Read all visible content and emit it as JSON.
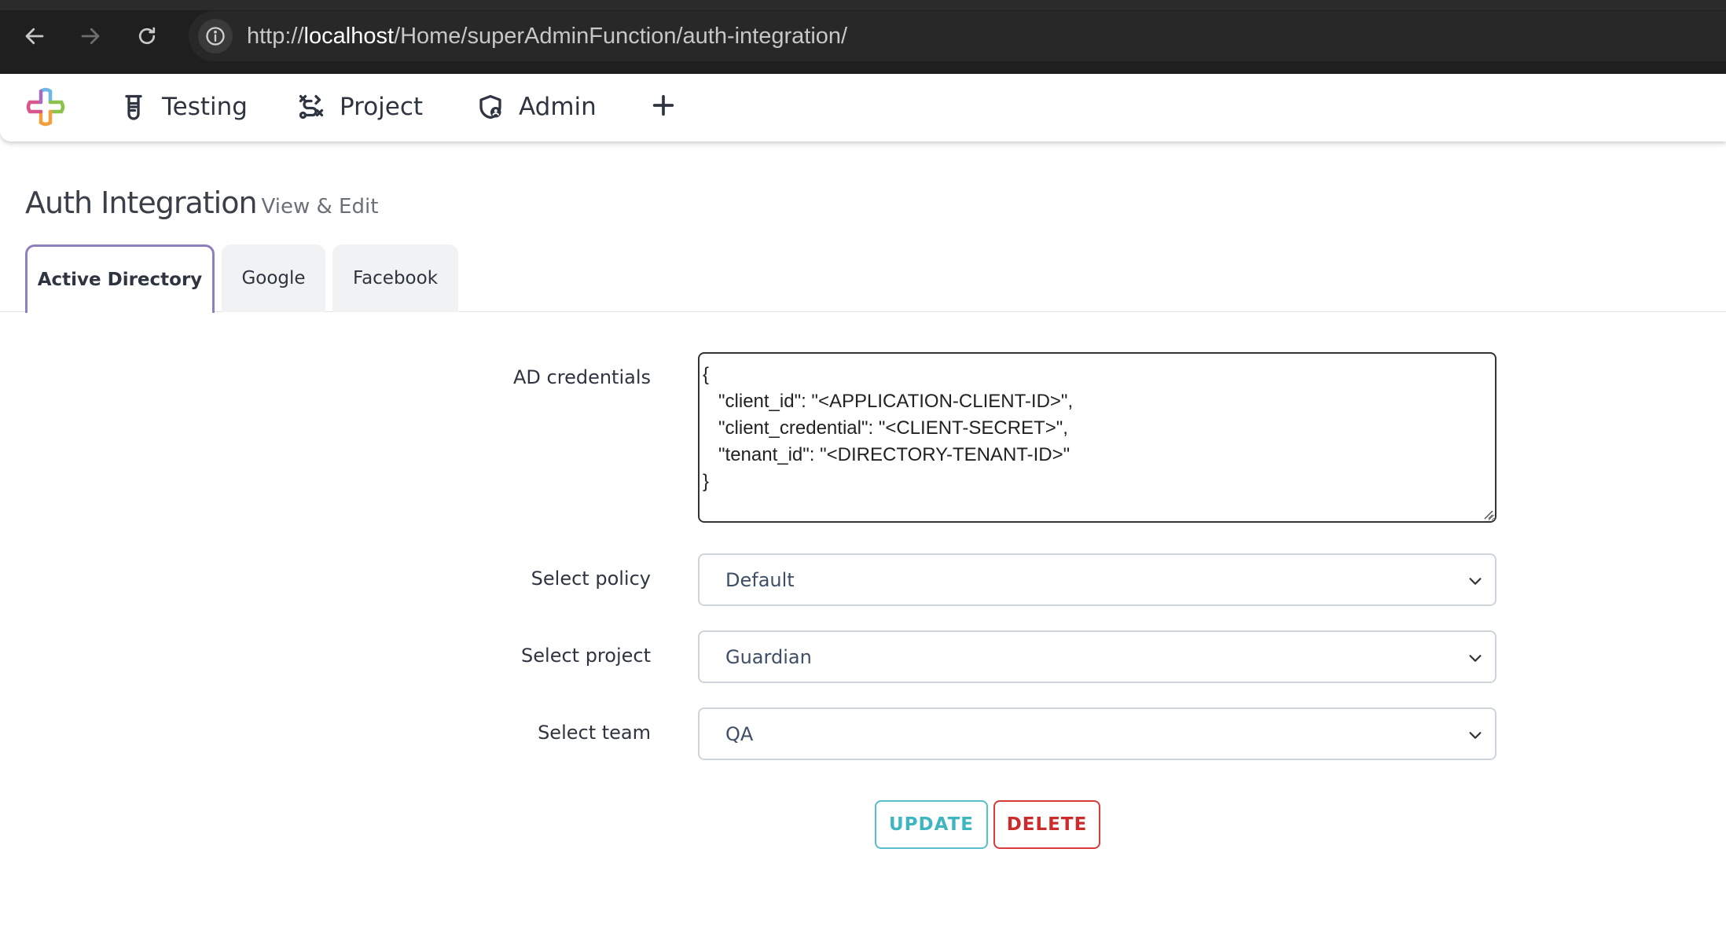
{
  "browser": {
    "url_scheme": "http://",
    "url_host": "localhost",
    "url_path": "/Home/superAdminFunction/auth-integration/"
  },
  "navbar": {
    "items": [
      {
        "label": "Testing",
        "icon": "flask-icon"
      },
      {
        "label": "Project",
        "icon": "route-icon"
      },
      {
        "label": "Admin",
        "icon": "shield-user-icon"
      }
    ],
    "add_icon": "plus-icon"
  },
  "page": {
    "title": "Auth Integration",
    "subtitle": "View & Edit"
  },
  "tabs": [
    {
      "label": "Active Directory",
      "active": true
    },
    {
      "label": "Google",
      "active": false
    },
    {
      "label": "Facebook",
      "active": false
    }
  ],
  "form": {
    "ad_credentials_label": "AD credentials",
    "ad_credentials_value": "{\n   \"client_id\": \"<APPLICATION-CLIENT-ID>\",\n   \"client_credential\": \"<CLIENT-SECRET>\",\n   \"tenant_id\": \"<DIRECTORY-TENANT-ID>\"\n}",
    "policy_label": "Select policy",
    "policy_value": "Default",
    "project_label": "Select project",
    "project_value": "Guardian",
    "team_label": "Select team",
    "team_value": "QA"
  },
  "actions": {
    "update_label": "UPDATE",
    "delete_label": "DELETE"
  },
  "colors": {
    "active_tab_border": "#8e7fbf",
    "update": "#3fb5c0",
    "delete": "#cc2b2b"
  }
}
